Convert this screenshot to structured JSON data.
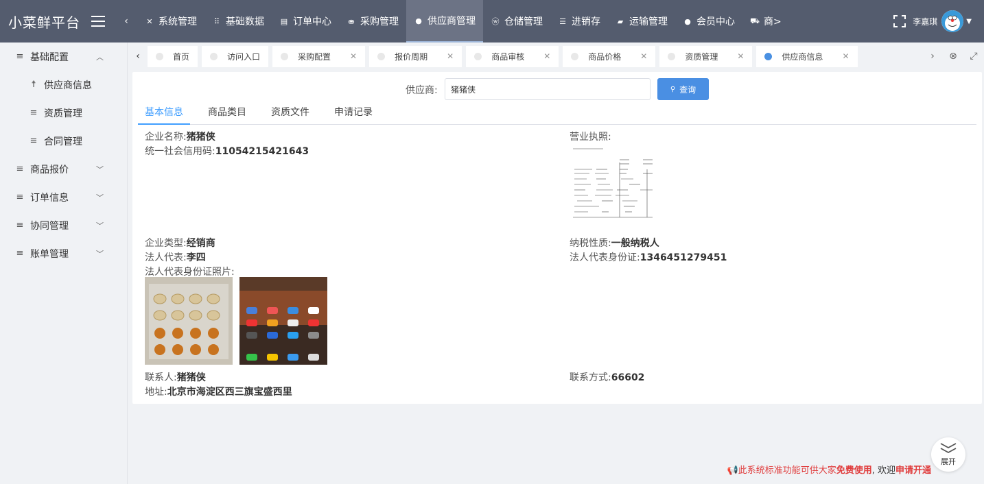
{
  "app": {
    "title": "小菜鲜平台"
  },
  "topnav": {
    "items": [
      {
        "label": "系统管理",
        "icon": "tools-icon"
      },
      {
        "label": "基础数据",
        "icon": "grid-icon"
      },
      {
        "label": "订单中心",
        "icon": "document-icon"
      },
      {
        "label": "采购管理",
        "icon": "basket-icon"
      },
      {
        "label": "供应商管理",
        "icon": "group-icon"
      },
      {
        "label": "仓储管理",
        "icon": "wordpress-icon"
      },
      {
        "label": "进销存",
        "icon": "sliders-icon"
      },
      {
        "label": "运输管理",
        "icon": "car-icon"
      },
      {
        "label": "会员中心",
        "icon": "user-icon"
      },
      {
        "label": "商>",
        "icon": "cart-icon"
      }
    ],
    "active_index": 4
  },
  "user": {
    "name": "李嘉琪"
  },
  "sidebar": {
    "items": [
      {
        "label": "基础配置",
        "arrow": "^"
      },
      {
        "label": "供应商信息"
      },
      {
        "label": "资质管理"
      },
      {
        "label": "合同管理"
      },
      {
        "label": "商品报价",
        "arrow": "v"
      },
      {
        "label": "订单信息",
        "arrow": "v"
      },
      {
        "label": "协同管理",
        "arrow": "v"
      },
      {
        "label": "账单管理",
        "arrow": "v"
      }
    ]
  },
  "tabs": {
    "items": [
      {
        "label": "首页",
        "closable": false
      },
      {
        "label": "访问入口",
        "closable": false
      },
      {
        "label": "采购配置",
        "closable": true
      },
      {
        "label": "报价周期",
        "closable": true
      },
      {
        "label": "商品审核",
        "closable": true
      },
      {
        "label": "商品价格",
        "closable": true
      },
      {
        "label": "资质管理",
        "closable": true
      },
      {
        "label": "供应商信息",
        "closable": true
      }
    ],
    "active_index": 7
  },
  "search": {
    "label": "供应商:",
    "value": "猪猪侠",
    "button": "查询"
  },
  "subtabs": [
    "基本信息",
    "商品类目",
    "资质文件",
    "申请记录"
  ],
  "info": {
    "company_name_label": "企业名称:",
    "company_name": "猪猪侠",
    "credit_code_label": "统一社会信用码:",
    "credit_code": "11054215421643",
    "license_label": "营业执照:",
    "company_type_label": "企业类型:",
    "company_type": "经销商",
    "tax_label": "纳税性质:",
    "tax": "一般纳税人",
    "legal_rep_label": "法人代表:",
    "legal_rep": "李四",
    "legal_id_label": "法人代表身份证:",
    "legal_id": "1346451279451",
    "id_photo_label": "法人代表身份证照片:",
    "contact_label": "联系人:",
    "contact": "猪猪侠",
    "phone_label": "联系方式:",
    "phone": "66602",
    "address_label": "地址:",
    "address": "北京市海淀区西三旗宝盛西里"
  },
  "footer": {
    "notice_a": "此系统标准功能可供大家",
    "notice_b": "免费使用",
    "notice_c": ", 欢迎",
    "notice_d": "申请开通",
    "expand_label": "展开"
  }
}
